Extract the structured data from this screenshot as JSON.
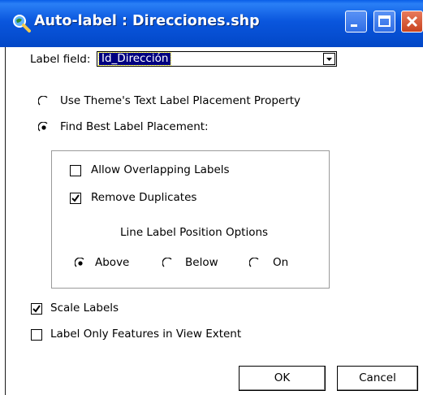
{
  "window": {
    "title": "Auto-label :  Direcciones.shp",
    "icons": {
      "app": "magnifier-globe-icon",
      "minimize": "minimize-icon",
      "maximize": "maximize-icon",
      "close": "close-icon"
    }
  },
  "label_field": {
    "label": "Label field:",
    "selected_value": "Id_Dirección"
  },
  "placement": {
    "use_theme_label": "Use Theme's Text Label Placement Property",
    "use_theme_selected": false,
    "find_best_label": "Find Best Label Placement:",
    "find_best_selected": true
  },
  "options_group": {
    "allow_overlapping": {
      "label": "Allow Overlapping Labels",
      "checked": false
    },
    "remove_duplicates": {
      "label": "Remove Duplicates",
      "checked": true
    },
    "line_label_heading": "Line Label Position Options",
    "positions": [
      {
        "label": "Above",
        "selected": true
      },
      {
        "label": "Below",
        "selected": false
      },
      {
        "label": "On",
        "selected": false
      }
    ]
  },
  "scale_labels": {
    "label": "Scale Labels",
    "checked": true
  },
  "view_extent": {
    "label": "Label Only Features in View Extent",
    "checked": false
  },
  "buttons": {
    "ok": "OK",
    "cancel": "Cancel"
  }
}
